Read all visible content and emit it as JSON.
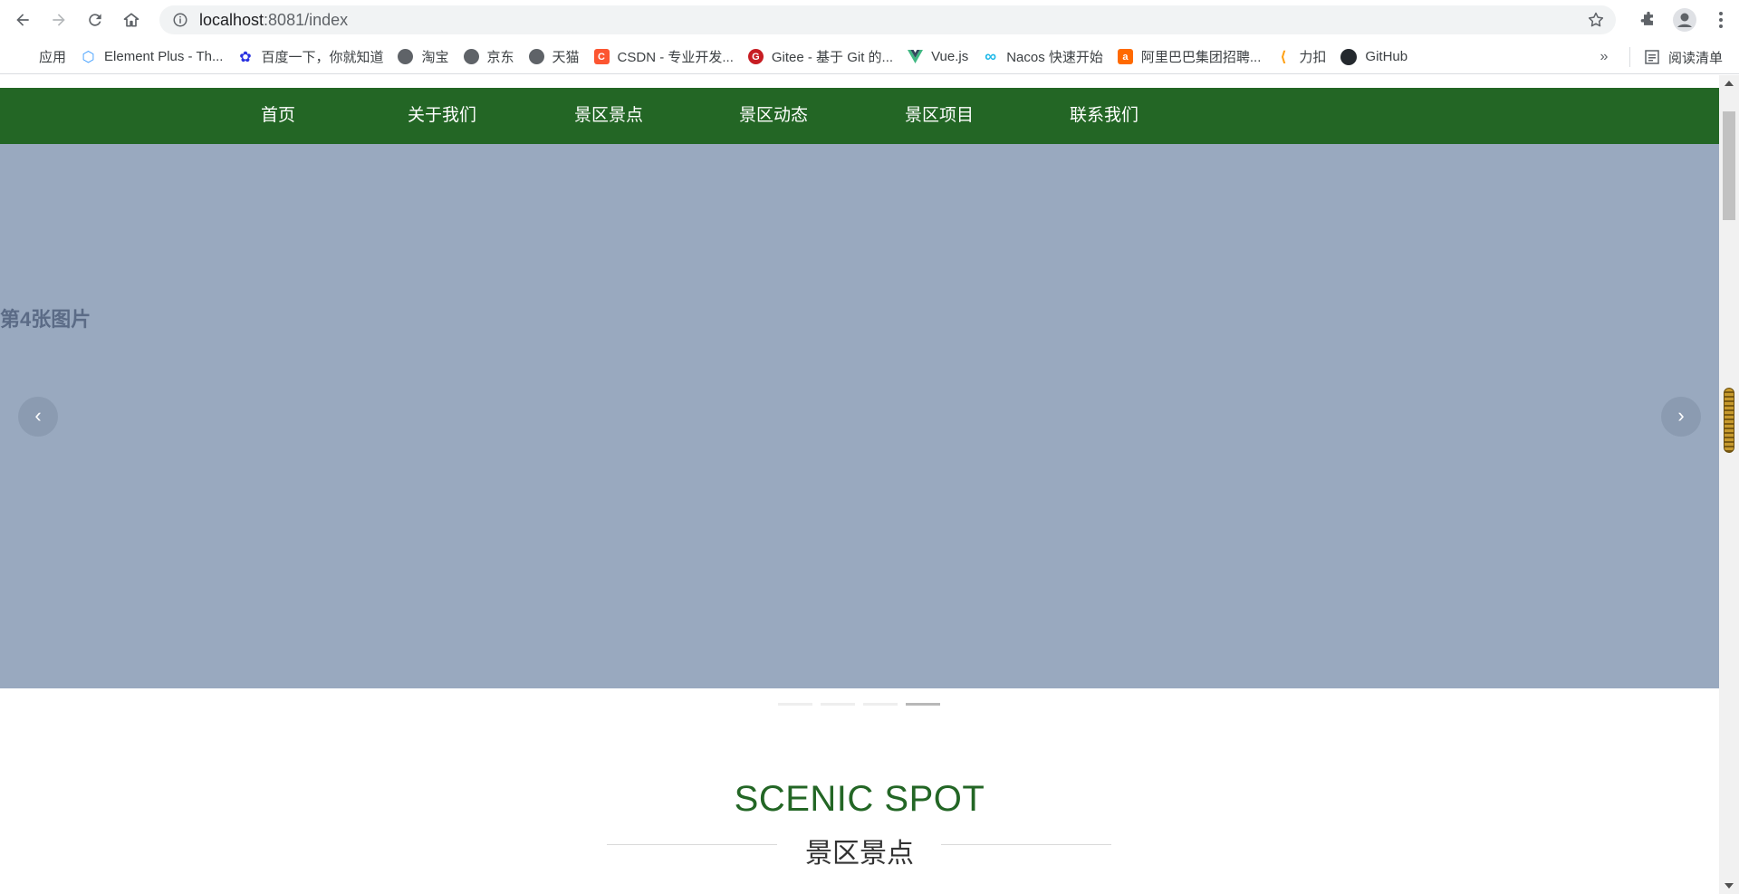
{
  "browser": {
    "url_host": "localhost",
    "url_rest": ":8081/index",
    "bookmarks": [
      {
        "label": "应用",
        "icon": "apps-grid-icon"
      },
      {
        "label": "Element Plus - Th...",
        "icon": "element-plus-icon"
      },
      {
        "label": "百度一下，你就知道",
        "icon": "baidu-icon"
      },
      {
        "label": "淘宝",
        "icon": "globe-icon"
      },
      {
        "label": "京东",
        "icon": "globe-icon"
      },
      {
        "label": "天猫",
        "icon": "globe-icon"
      },
      {
        "label": "CSDN - 专业开发...",
        "icon": "csdn-icon"
      },
      {
        "label": "Gitee - 基于 Git 的...",
        "icon": "gitee-icon"
      },
      {
        "label": "Vue.js",
        "icon": "vue-icon"
      },
      {
        "label": "Nacos 快速开始",
        "icon": "nacos-icon"
      },
      {
        "label": "阿里巴巴集团招聘...",
        "icon": "alibaba-icon"
      },
      {
        "label": "力扣",
        "icon": "leetcode-icon"
      },
      {
        "label": "GitHub",
        "icon": "github-icon"
      }
    ],
    "more": "»",
    "reading_list": "阅读清单"
  },
  "site_nav": {
    "items": [
      "首页",
      "关于我们",
      "景区景点",
      "景区动态",
      "景区项目",
      "联系我们"
    ]
  },
  "carousel": {
    "slide_text": "第4张图片",
    "prev": "‹",
    "next": "›",
    "total": 4,
    "active": 4
  },
  "section": {
    "title_en": "SCENIC SPOT",
    "title_zh": "景区景点"
  },
  "colors": {
    "nav_green": "#236625",
    "carousel_bg": "#99a9bf"
  }
}
